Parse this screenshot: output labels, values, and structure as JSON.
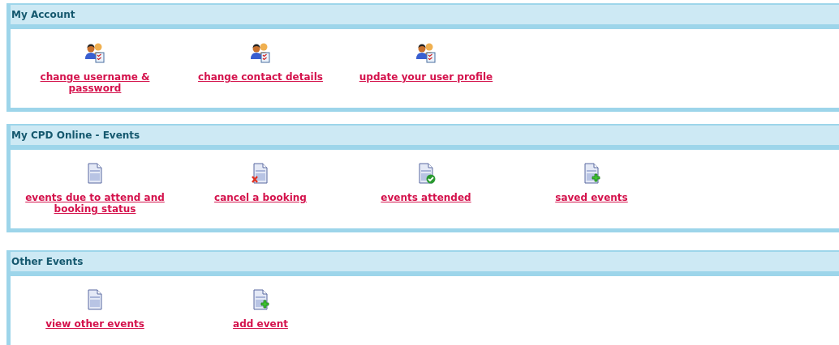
{
  "panels": [
    {
      "title": "My Account",
      "items": [
        {
          "label": "change username & password",
          "kind": "users"
        },
        {
          "label": "change contact details",
          "kind": "users"
        },
        {
          "label": "update your user profile",
          "kind": "users"
        }
      ]
    },
    {
      "title": "My CPD Online - Events",
      "items": [
        {
          "label": "events due to attend and booking status",
          "kind": "document"
        },
        {
          "label": "cancel a booking",
          "kind": "cancel"
        },
        {
          "label": "events attended",
          "kind": "check"
        },
        {
          "label": "saved events",
          "kind": "add"
        }
      ]
    },
    {
      "title": "Other Events",
      "items": [
        {
          "label": "view other events",
          "kind": "document"
        },
        {
          "label": "add event",
          "kind": "add"
        }
      ]
    }
  ]
}
